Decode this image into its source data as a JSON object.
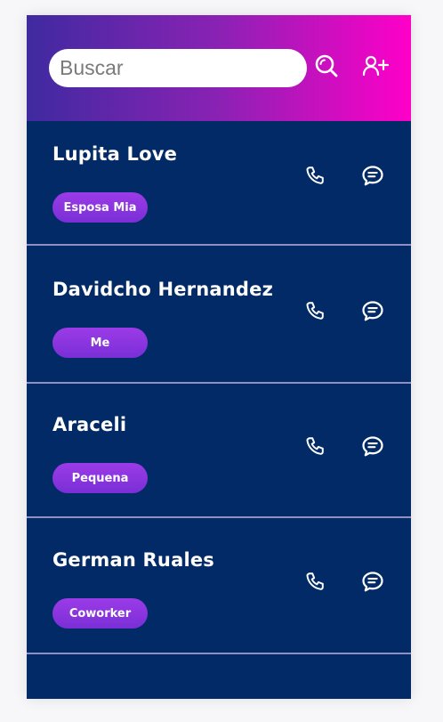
{
  "search": {
    "placeholder": "Buscar",
    "value": ""
  },
  "header": {
    "search_icon": "search-icon",
    "add_contact_icon": "add-user-icon"
  },
  "contacts": [
    {
      "name": "Lupita Love",
      "tag": "Esposa Mia"
    },
    {
      "name": "Davidcho Hernandez",
      "tag": "Me"
    },
    {
      "name": "Araceli",
      "tag": "Pequena"
    },
    {
      "name": "German Ruales",
      "tag": "Coworker"
    }
  ],
  "icons": {
    "call": "phone-icon",
    "message": "chat-bubble-icon"
  },
  "colors": {
    "background": "#022a66",
    "header_gradient_start": "#3f2aa0",
    "header_gradient_end": "#ff00c8",
    "tag": "#8a35e0",
    "divider": "#8f8fc4"
  }
}
